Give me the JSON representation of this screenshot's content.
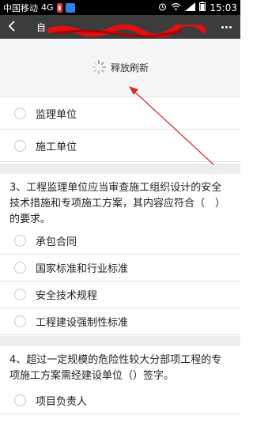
{
  "status_bar": {
    "carrier": "中国移动",
    "network": "4G",
    "clock": "15:03"
  },
  "title_bar": {
    "title": "自"
  },
  "refresh": {
    "label": "释放刷新"
  },
  "questions": [
    {
      "text": "",
      "options": [
        "监理单位",
        "施工单位"
      ]
    },
    {
      "text": "3、工程监理单位应当审查施工组织设计的安全技术措施和专项施工方案，其内容应符合（　）的要求。",
      "options": [
        "承包合同",
        "国家标准和行业标准",
        "安全技术规程",
        "工程建设强制性标准"
      ]
    },
    {
      "text": "4、超过一定规模的危险性较大分部项工程的专项施工方案需经建设单位（）签字。",
      "options": [
        "项目负责人"
      ]
    }
  ],
  "colors": {
    "annotation": "#d32f2f",
    "title_bar": "#3c3c3c"
  }
}
